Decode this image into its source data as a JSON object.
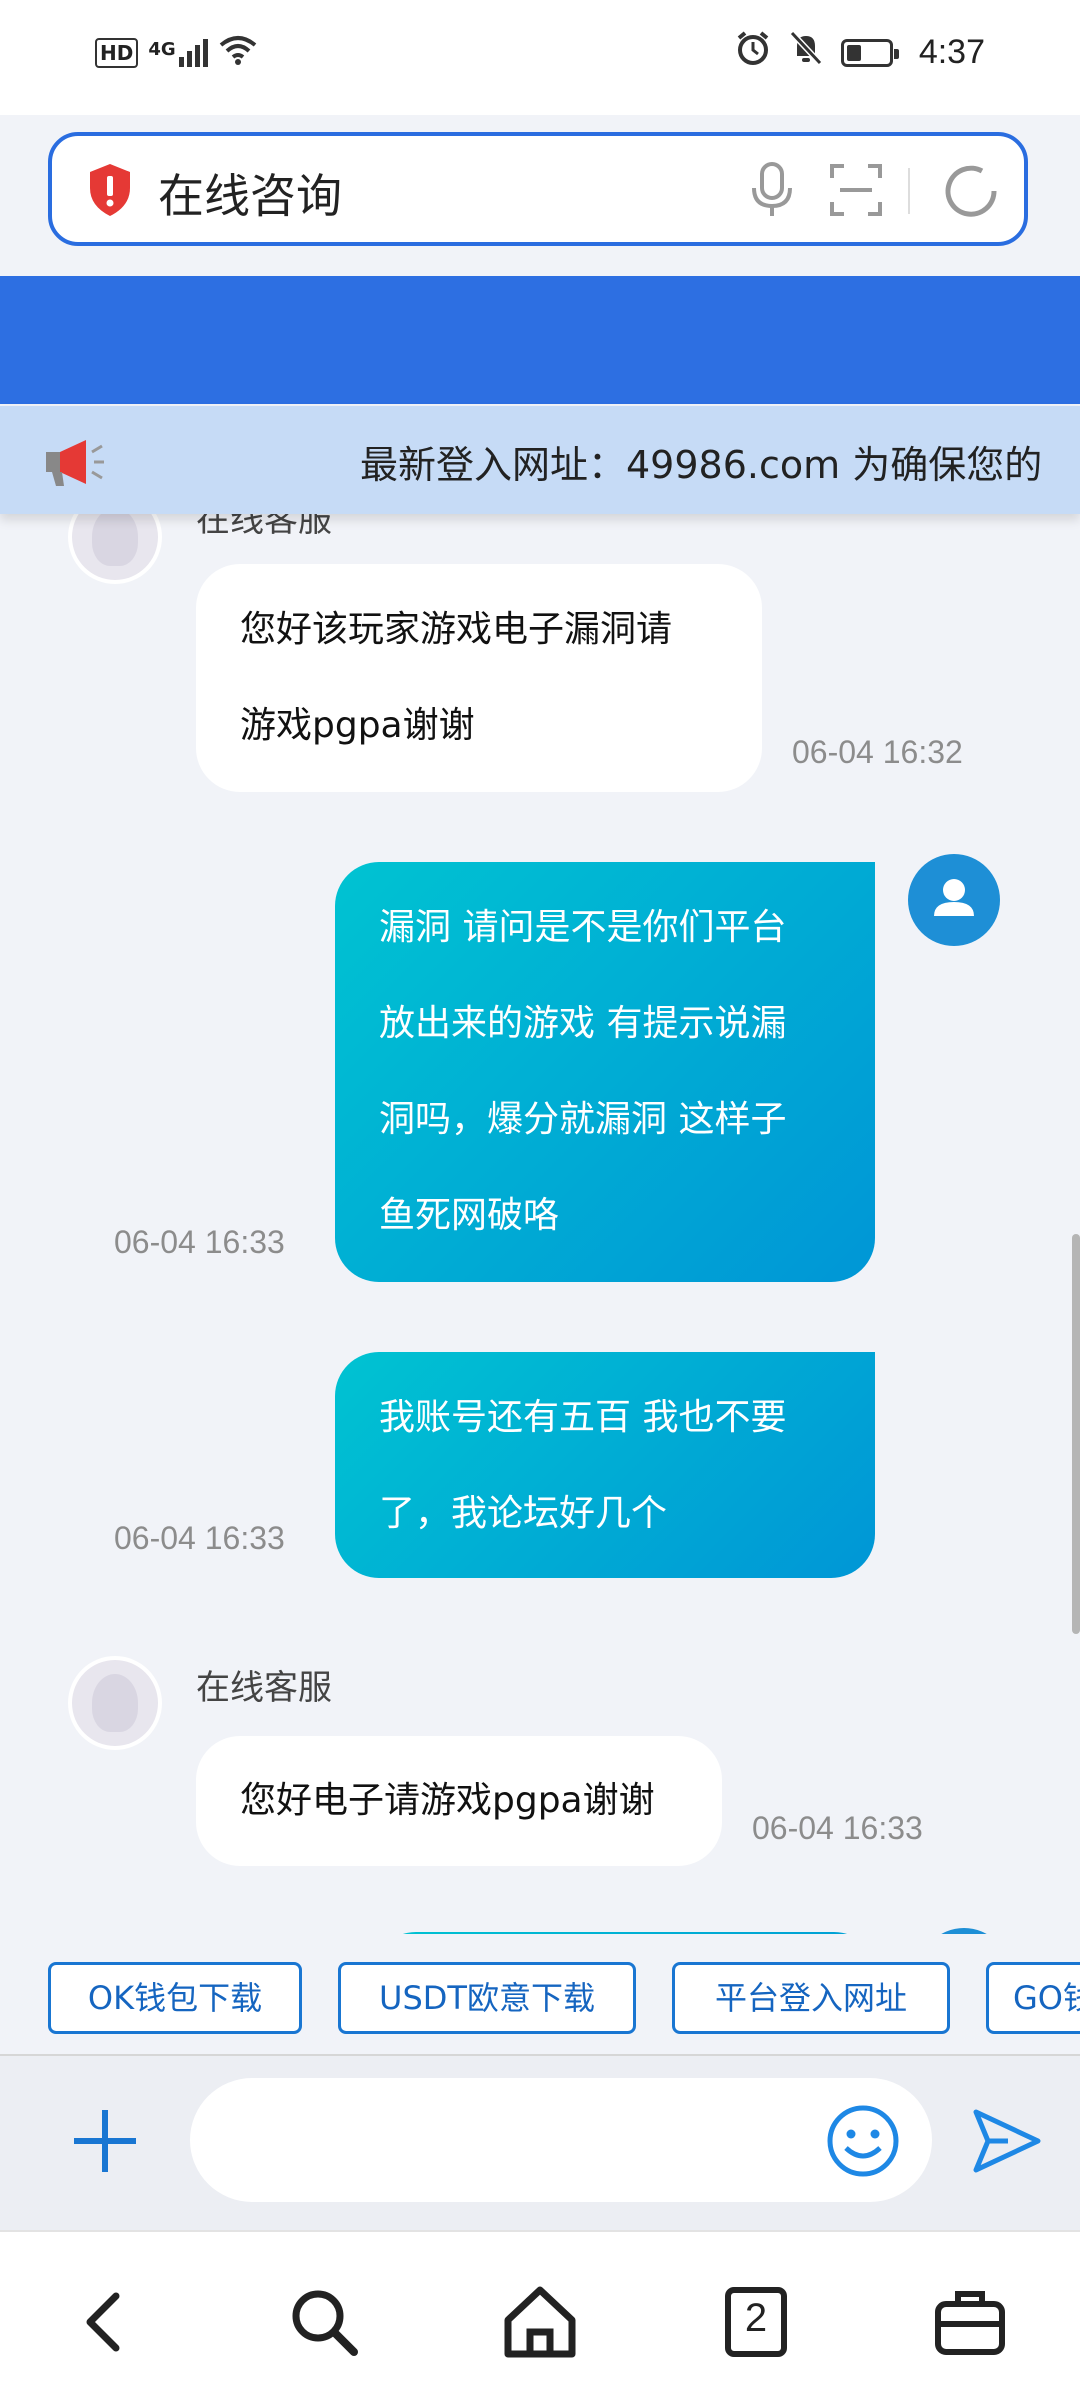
{
  "status_bar": {
    "network": "HD",
    "signal_label": "4G",
    "time": "4:37"
  },
  "address_bar": {
    "title": "在线咨询"
  },
  "notice": {
    "text": "最新登入网址：49986.com 为确保您的"
  },
  "messages": [
    {
      "type": "in",
      "sender": "在线客服",
      "lines": [
        "您好该玩家游戏电子漏洞请",
        "游戏pgpa谢谢"
      ],
      "time": "06-04 16:32"
    },
    {
      "type": "out",
      "lines": [
        "漏洞 请问是不是你们平台",
        "放出来的游戏 有提示说漏",
        "洞吗，爆分就漏洞 这样子",
        "鱼死网破咯"
      ],
      "time": "06-04 16:33"
    },
    {
      "type": "out",
      "lines": [
        "我账号还有五百 我也不要",
        "了，我论坛好几个"
      ],
      "time": "06-04 16:33"
    },
    {
      "type": "in",
      "sender": "在线客服",
      "lines": [
        "您好电子请游戏pgpa谢谢"
      ],
      "time": "06-04 16:33"
    }
  ],
  "quick_actions": [
    "OK钱包下载",
    "USDT欧意下载",
    "平台登入网址",
    "GO钱"
  ],
  "composer": {
    "placeholder": ""
  },
  "nav": {
    "tabs_count": "2"
  },
  "colors": {
    "brand_blue": "#2d6fe2",
    "notice_bg": "#c6dbf6",
    "bubble_gradient_start": "#00c3d2",
    "bubble_gradient_end": "#0096d6",
    "link_blue": "#1976d2"
  }
}
